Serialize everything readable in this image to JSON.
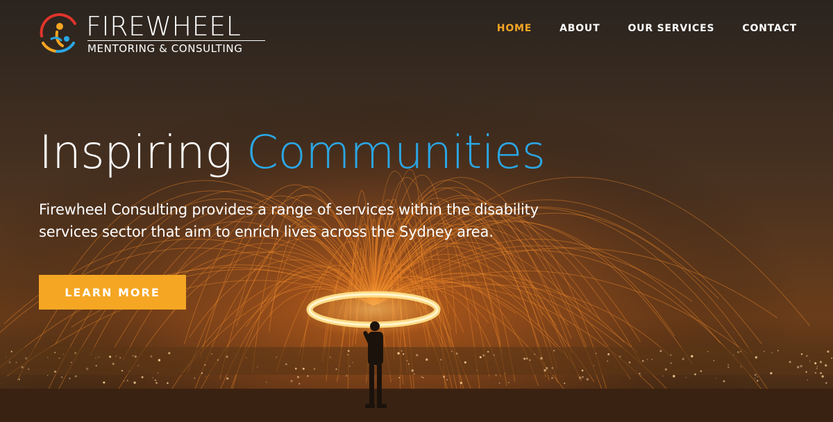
{
  "brand": {
    "name": "FIREWHEEL",
    "tagline": "MENTORING & CONSULTING",
    "logo_icon": "firewheel-logo-icon"
  },
  "nav": {
    "items": [
      {
        "label": "HOME",
        "active": true
      },
      {
        "label": "ABOUT",
        "active": false
      },
      {
        "label": "OUR SERVICES",
        "active": false
      },
      {
        "label": "CONTACT",
        "active": false
      }
    ]
  },
  "hero": {
    "headline_part1": "Inspiring",
    "headline_part2": "Communities",
    "description": "Firewheel Consulting provides a range of services within the disability services sector that aim to enrich lives across the Sydney area.",
    "cta_label": "LEARN MORE",
    "background": "steel-wool-fire-spin-photo"
  },
  "colors": {
    "accent_orange": "#f5a623",
    "accent_blue": "#2ba6e4",
    "text": "#ffffff"
  }
}
